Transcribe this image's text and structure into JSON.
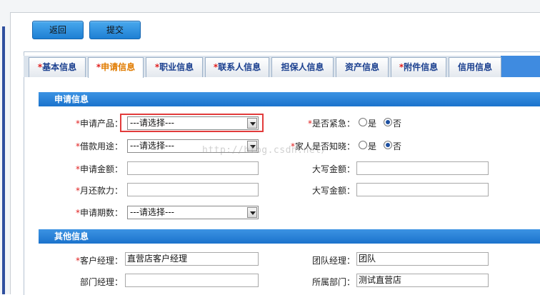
{
  "toolbar": {
    "back_label": "返回",
    "submit_label": "提交"
  },
  "tabs": [
    {
      "label": "基本信息",
      "required": "*"
    },
    {
      "label": "申请信息",
      "required": "*"
    },
    {
      "label": "职业信息",
      "required": "*"
    },
    {
      "label": "联系人信息",
      "required": "*"
    },
    {
      "label": "担保人信息",
      "required": ""
    },
    {
      "label": "资产信息",
      "required": ""
    },
    {
      "label": "附件信息",
      "required": "*"
    },
    {
      "label": "信用信息",
      "required": ""
    }
  ],
  "sections": {
    "apply_info": "申请信息",
    "other_info": "其他信息"
  },
  "form": {
    "star": "*",
    "product_label": "申请产品：",
    "product_value": "---请选择---",
    "purpose_label": "借款用途：",
    "purpose_value": "---请选择---",
    "amount_label": "申请金额：",
    "amount_value": "",
    "repay_label": "月还款力：",
    "repay_value": "",
    "term_label": "申请期数：",
    "term_value": "---请选择---",
    "urgent_label": "是否紧急：",
    "family_label": "家人是否知晓：",
    "yes": "是",
    "no": "否",
    "upper1_label": "大写金额：",
    "upper1_value": "",
    "upper2_label": "大写金额：",
    "upper2_value": ""
  },
  "other": {
    "manager_label": "客户经理：",
    "manager_value": "直营店客户经理",
    "team_label": "团队经理：",
    "team_value": "团队",
    "dept_mgr_label": "部门经理：",
    "dept_mgr_value": "",
    "dept_label": "所属部门：",
    "dept_value": "测试直营店"
  },
  "watermark": "http://blog.csdn.net/",
  "colors": {
    "accent": "#1b73cc",
    "required": "#e02020",
    "active_tab": "#e07b00"
  }
}
